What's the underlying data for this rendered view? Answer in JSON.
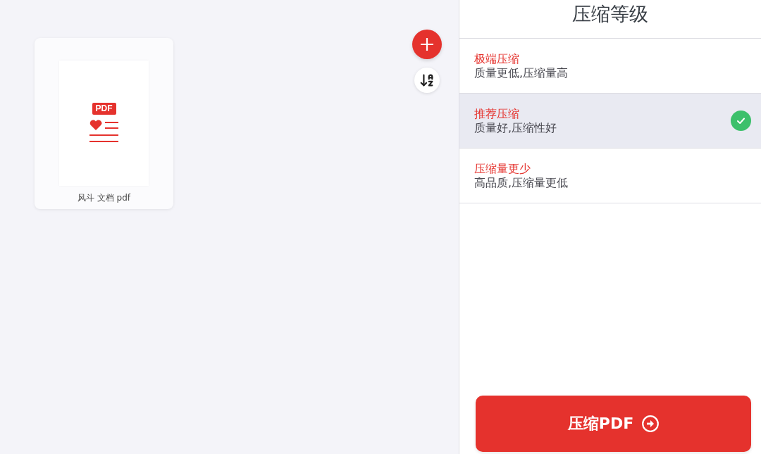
{
  "files": [
    {
      "type_label": "PDF",
      "name": "风斗 文档 pdf"
    }
  ],
  "panel": {
    "title": "压缩等级",
    "options": [
      {
        "title": "极端压缩",
        "description": "质量更低,压缩量高",
        "selected": false
      },
      {
        "title": "推荐压缩",
        "description": "质量好,压缩性好",
        "selected": true
      },
      {
        "title": "压缩量更少",
        "description": "高品质,压缩量更低",
        "selected": false
      }
    ]
  },
  "submit_button": {
    "label": "压缩PDF"
  }
}
